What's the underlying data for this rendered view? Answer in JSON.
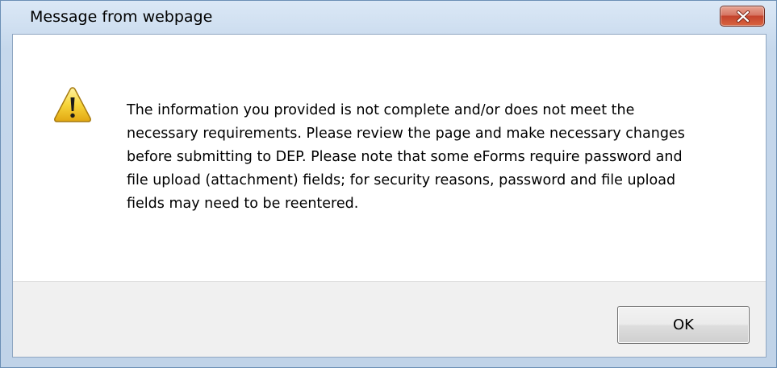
{
  "window": {
    "title": "Message from webpage",
    "close_icon": "close-icon"
  },
  "dialog": {
    "icon": "warning-icon",
    "message": "The information you provided is not complete and/or does not meet the necessary requirements.  Please review the page and make necessary changes before submitting to DEP.  Please note that some eForms require password and file upload (attachment) fields; for security reasons, password and file upload fields may need to be reentered."
  },
  "buttons": {
    "ok_label": "OK"
  },
  "colors": {
    "titlebar": "#c6d8ec",
    "close_button": "#c4432d",
    "button_area": "#f0f0f0"
  }
}
